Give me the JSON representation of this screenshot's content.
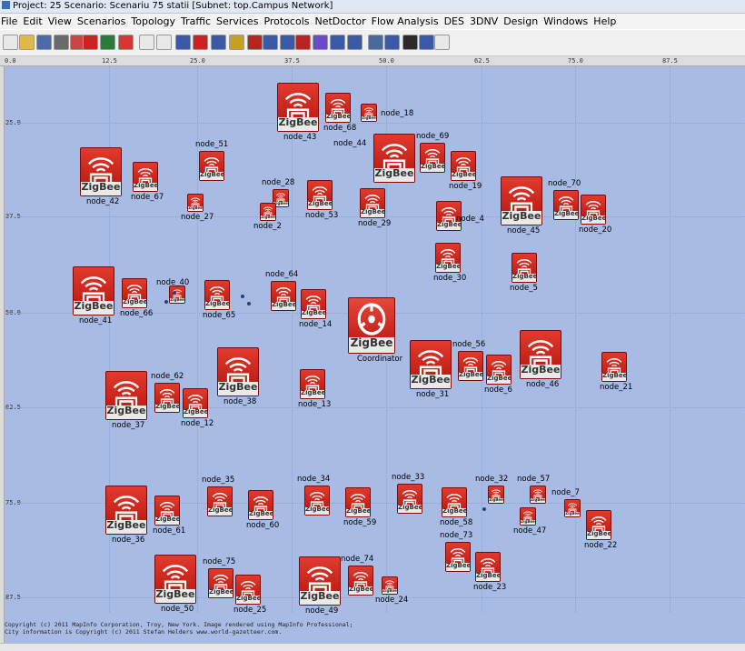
{
  "window": {
    "title": "Project: 25 Scenario: Scenariu 75 statii  [Subnet: top.Campus Network]"
  },
  "menu": [
    "File",
    "Edit",
    "View",
    "Scenarios",
    "Topology",
    "Traffic",
    "Services",
    "Protocols",
    "NetDoctor",
    "Flow Analysis",
    "DES",
    "3DNV",
    "Design",
    "Windows",
    "Help"
  ],
  "toolbar": {
    "icons": [
      "new-file-icon",
      "open-folder-icon",
      "save-icon",
      "print-icon",
      "scan-icon",
      "object-palette-icon",
      "verify-links-icon",
      "fail-recover-icon",
      "zoom-in-icon",
      "zoom-out-icon",
      "import-traffic-icon",
      "import-topology-icon",
      "export-icon",
      "configure-run-icon",
      "hierarchy-icon",
      "layout-icon",
      "device-config-icon",
      "edit-attributes-icon",
      "rapid-config-icon",
      "chart-icon",
      "results-icon",
      "flow-analysis-icon",
      "netdoctor-icon",
      "report-icon",
      "dashboard-icon",
      "help-icon"
    ],
    "colors": [
      "#e8e8e8",
      "#e0b84a",
      "#4a6aa8",
      "#6a6a6a",
      "#c44",
      "#c22",
      "#2a7a3a",
      "#d33",
      "#e8e8e8",
      "#e8e8e8",
      "#3a5aa8",
      "#c22",
      "#3a5aa8",
      "#c8a020",
      "#b22",
      "#3a5aa8",
      "#3a5aa8",
      "#b22",
      "#6a4ac8",
      "#3a5aa8",
      "#3a5aa8",
      "#4a6a9a",
      "#3a5aa8",
      "#2a2a2a",
      "#3a5aa8",
      "#e8e8e8"
    ]
  },
  "ruler": {
    "top": [
      "0.0",
      "12.5",
      "25.0",
      "37.5",
      "50.0",
      "62.5",
      "75.0",
      "87.5"
    ],
    "left": [
      "25.0",
      "37.5",
      "50.0",
      "62.5",
      "75.0",
      "87.5"
    ]
  },
  "icon_label": "ZigBee",
  "nodes": [
    {
      "id": "node_43",
      "label": "node_43",
      "size": "L"
    },
    {
      "id": "node_68",
      "label": "node_68",
      "size": "M"
    },
    {
      "id": "node_18",
      "label": "node_18",
      "size": "S"
    },
    {
      "id": "node_44",
      "label": "node_44",
      "size": "L"
    },
    {
      "id": "node_69",
      "label": "node_69",
      "size": "M"
    },
    {
      "id": "node_19",
      "label": "node_19",
      "size": "M"
    },
    {
      "id": "node_51",
      "label": "node_51",
      "size": "M"
    },
    {
      "id": "node_42",
      "label": "node_42",
      "size": "L"
    },
    {
      "id": "node_67",
      "label": "node_67",
      "size": "M"
    },
    {
      "id": "node_28",
      "label": "node_28",
      "size": "S"
    },
    {
      "id": "node_27",
      "label": "node_27",
      "size": "S"
    },
    {
      "id": "node_2",
      "label": "node_2",
      "size": "S"
    },
    {
      "id": "node_53",
      "label": "node_53",
      "size": "M"
    },
    {
      "id": "node_29",
      "label": "node_29",
      "size": "M"
    },
    {
      "id": "node_4",
      "label": "node_4",
      "size": "M"
    },
    {
      "id": "node_45",
      "label": "node_45",
      "size": "L"
    },
    {
      "id": "node_70",
      "label": "node_70",
      "size": "M"
    },
    {
      "id": "node_20",
      "label": "node_20",
      "size": "M"
    },
    {
      "id": "node_30",
      "label": "node_30",
      "size": "M"
    },
    {
      "id": "node_5",
      "label": "node_5",
      "size": "M"
    },
    {
      "id": "node_40",
      "label": "node_40",
      "size": "S"
    },
    {
      "id": "node_41",
      "label": "node_41",
      "size": "L"
    },
    {
      "id": "node_66",
      "label": "node_66",
      "size": "M"
    },
    {
      "id": "node_65",
      "label": "node_65",
      "size": "M"
    },
    {
      "id": "node_64",
      "label": "node_64",
      "size": "M"
    },
    {
      "id": "node_14",
      "label": "node_14",
      "size": "M"
    },
    {
      "id": "coordinator",
      "label": "Coordinator",
      "size": "C"
    },
    {
      "id": "node_56",
      "label": "node_56",
      "size": "M"
    },
    {
      "id": "node_31",
      "label": "node_31",
      "size": "L"
    },
    {
      "id": "node_6",
      "label": "node_6",
      "size": "M"
    },
    {
      "id": "node_46",
      "label": "node_46",
      "size": "L"
    },
    {
      "id": "node_21",
      "label": "node_21",
      "size": "M"
    },
    {
      "id": "node_62",
      "label": "node_62",
      "size": "M"
    },
    {
      "id": "node_37",
      "label": "node_37",
      "size": "L"
    },
    {
      "id": "node_12",
      "label": "node_12",
      "size": "M"
    },
    {
      "id": "node_38",
      "label": "node_38",
      "size": "L"
    },
    {
      "id": "node_13",
      "label": "node_13",
      "size": "M"
    },
    {
      "id": "node_35",
      "label": "node_35",
      "size": "M"
    },
    {
      "id": "node_34",
      "label": "node_34",
      "size": "M"
    },
    {
      "id": "node_33",
      "label": "node_33",
      "size": "M"
    },
    {
      "id": "node_32",
      "label": "node_32",
      "size": "S"
    },
    {
      "id": "node_57",
      "label": "node_57",
      "size": "S"
    },
    {
      "id": "node_7",
      "label": "node_7",
      "size": "S"
    },
    {
      "id": "node_36",
      "label": "node_36",
      "size": "L"
    },
    {
      "id": "node_61",
      "label": "node_61",
      "size": "M"
    },
    {
      "id": "node_60",
      "label": "node_60",
      "size": "M"
    },
    {
      "id": "node_59",
      "label": "node_59",
      "size": "M"
    },
    {
      "id": "node_58",
      "label": "node_58",
      "size": "M"
    },
    {
      "id": "node_47",
      "label": "node_47",
      "size": "S"
    },
    {
      "id": "node_22",
      "label": "node_22",
      "size": "M"
    },
    {
      "id": "node_75",
      "label": "node_75",
      "size": "M"
    },
    {
      "id": "node_74",
      "label": "node_74",
      "size": "M"
    },
    {
      "id": "node_73",
      "label": "node_73",
      "size": "M"
    },
    {
      "id": "node_50",
      "label": "node_50",
      "size": "L"
    },
    {
      "id": "node_25",
      "label": "node_25",
      "size": "M"
    },
    {
      "id": "node_49",
      "label": "node_49",
      "size": "L"
    },
    {
      "id": "node_24",
      "label": "node_24",
      "size": "S"
    },
    {
      "id": "node_23",
      "label": "node_23",
      "size": "M"
    }
  ],
  "copyright": [
    "Copyright (c) 2011 MapInfo Corporation, Troy, New York. Image rendered using MapInfo Professional;",
    "City information is Copyright (c) 2011 Stefan Helders www.world-gazetteer.com."
  ]
}
